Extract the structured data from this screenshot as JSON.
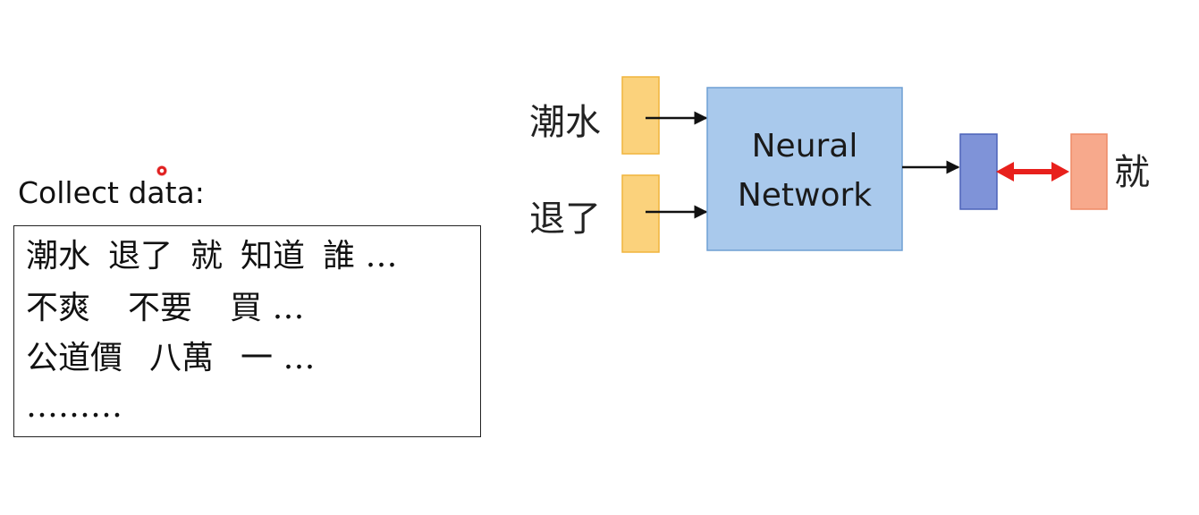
{
  "left_panel": {
    "title": "Collect data:",
    "data_lines": [
      [
        "潮水",
        "退了",
        "就",
        "知道",
        "誰 …"
      ],
      [
        "不爽",
        "不要",
        "買 …"
      ],
      [
        "公道價",
        "八萬",
        "一 …"
      ],
      [
        "………"
      ]
    ]
  },
  "diagram": {
    "inputs": [
      "潮水",
      "退了"
    ],
    "network_label_line1": "Neural",
    "network_label_line2": "Network",
    "target": "就",
    "colors": {
      "input_fill": "#fbd27c",
      "input_stroke": "#f0b43c",
      "network_fill": "#a9c9ec",
      "network_stroke": "#6f9fd3",
      "output_fill": "#7f93d8",
      "output_stroke": "#4c62b8",
      "target_fill": "#f7a98c",
      "target_stroke": "#ee8a66",
      "compare_arrow": "#e8201c",
      "arrow": "#111111"
    }
  }
}
